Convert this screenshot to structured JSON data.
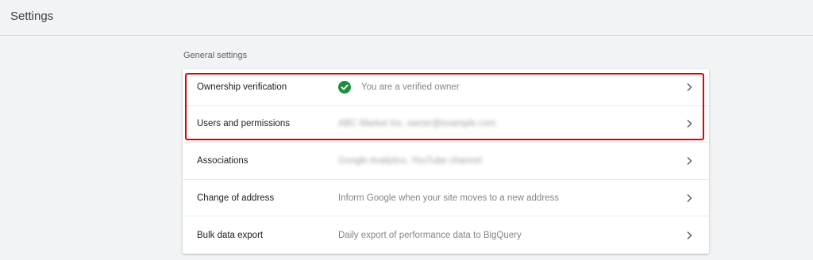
{
  "page": {
    "title": "Settings"
  },
  "general_settings": {
    "section_title": "General settings",
    "rows": [
      {
        "label": "Ownership verification",
        "value": "You are a verified owner",
        "icon": "check-circle-icon",
        "blurred": false
      },
      {
        "label": "Users and permissions",
        "value": "ABC Market Inc, owner@example.com",
        "blurred": true
      },
      {
        "label": "Associations",
        "value": "Google Analytics, YouTube channel",
        "blurred": true
      },
      {
        "label": "Change of address",
        "value": "Inform Google when your site moves to a new address",
        "blurred": false
      },
      {
        "label": "Bulk data export",
        "value": "Daily export of performance data to BigQuery",
        "blurred": false
      }
    ]
  },
  "colors": {
    "background": "#f1f3f4",
    "card": "#ffffff",
    "verified_green": "#1e8e3e",
    "highlight_red": "#e00000",
    "secondary_text": "#80868b"
  }
}
